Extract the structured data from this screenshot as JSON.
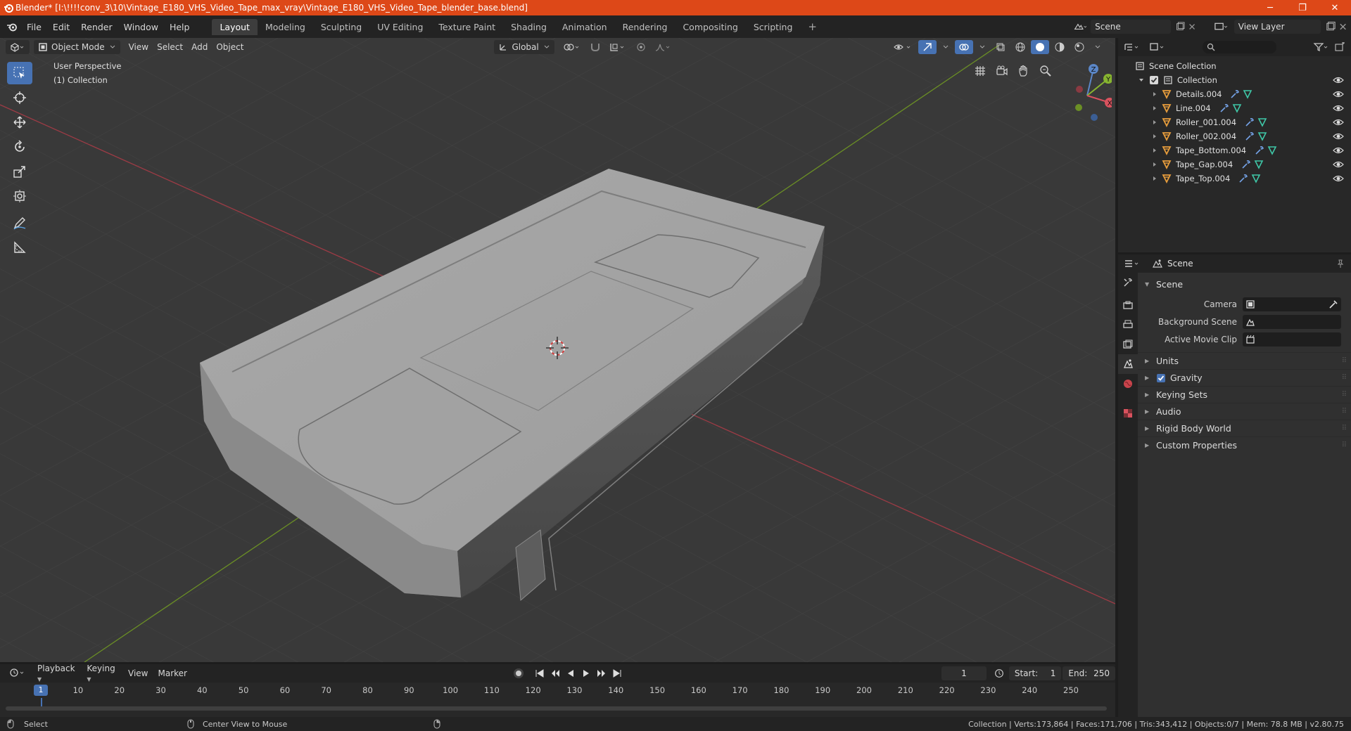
{
  "titlebar": {
    "title": "Blender* [I:\\!!!!conv_3\\10\\Vintage_E180_VHS_Video_Tape_max_vray\\Vintage_E180_VHS_Video_Tape_blender_base.blend]",
    "minimize": "─",
    "maximize": "❐",
    "close": "✕"
  },
  "menu": [
    "File",
    "Edit",
    "Render",
    "Window",
    "Help"
  ],
  "workspaces": [
    {
      "label": "Layout",
      "active": true
    },
    {
      "label": "Modeling"
    },
    {
      "label": "Sculpting"
    },
    {
      "label": "UV Editing"
    },
    {
      "label": "Texture Paint"
    },
    {
      "label": "Shading"
    },
    {
      "label": "Animation"
    },
    {
      "label": "Rendering"
    },
    {
      "label": "Compositing"
    },
    {
      "label": "Scripting"
    }
  ],
  "add_workspace": "+",
  "scene_selector": {
    "value": "Scene"
  },
  "view_layer_selector": {
    "value": "View Layer"
  },
  "viewport": {
    "mode": "Object Mode",
    "menus": [
      "View",
      "Select",
      "Add",
      "Object"
    ],
    "orientation": "Global",
    "perspective_label": "User Perspective",
    "collection_label": "(1) Collection",
    "grid_color": "#444444",
    "axis_x_color": "#9c3b45",
    "axis_y_color": "#6b8f25",
    "gizmo": {
      "x": "X",
      "y": "Y",
      "z": "Z"
    }
  },
  "outliner": {
    "scene_collection": "Scene Collection",
    "collection": "Collection",
    "objects": [
      {
        "name": "Details.004"
      },
      {
        "name": "Line.004"
      },
      {
        "name": "Roller_001.004"
      },
      {
        "name": "Roller_002.004"
      },
      {
        "name": "Tape_Bottom.004"
      },
      {
        "name": "Tape_Gap.004"
      },
      {
        "name": "Tape_Top.004"
      }
    ]
  },
  "properties": {
    "header_title": "Scene",
    "panel_title": "Scene",
    "camera_label": "Camera",
    "background_scene_label": "Background Scene",
    "active_movie_clip_label": "Active Movie Clip",
    "subpanels": [
      {
        "label": "Units"
      },
      {
        "label": "Gravity",
        "checkbox": true
      },
      {
        "label": "Keying Sets"
      },
      {
        "label": "Audio"
      },
      {
        "label": "Rigid Body World"
      },
      {
        "label": "Custom Properties"
      }
    ]
  },
  "timeline": {
    "menus": [
      "Playback",
      "Keying",
      "View",
      "Marker"
    ],
    "current_frame": "1",
    "start_label": "Start:",
    "start": "1",
    "end_label": "End:",
    "end": "250",
    "ticks": [
      "10",
      "20",
      "30",
      "40",
      "50",
      "60",
      "70",
      "80",
      "90",
      "100",
      "110",
      "120",
      "130",
      "140",
      "150",
      "160",
      "170",
      "180",
      "190",
      "200",
      "210",
      "220",
      "230",
      "240",
      "250"
    ],
    "cursor_frame": "1"
  },
  "statusbar": {
    "left_action": "Select",
    "middle_action": "Center View to Mouse",
    "stats": "Collection | Verts:173,864 | Faces:171,706 | Tris:343,412 | Objects:0/7 | Mem: 78.8 MB | v2.80.75"
  },
  "colors": {
    "titlebar": "#dd4818",
    "accent": "#4772b3",
    "object_icon": "#e79d3c",
    "modifier_icon": "#74a2e6",
    "mesh_icon": "#3fc7a7"
  }
}
